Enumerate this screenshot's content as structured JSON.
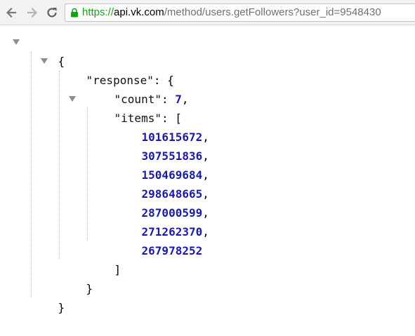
{
  "browser": {
    "url_scheme": "https://",
    "url_host": "api.vk.com",
    "url_path": "/method/users.getFollowers?user_id=9548430",
    "back_icon": "back-arrow-icon",
    "forward_icon": "forward-arrow-icon",
    "reload_icon": "reload-icon",
    "lock_icon": "lock-icon",
    "colors": {
      "secure": "#16a316",
      "path": "#707070",
      "number": "#1a1aa6"
    }
  },
  "json": {
    "open_root": "{",
    "response_key": "\"response\"",
    "response_open": ": {",
    "count_key": "\"count\"",
    "count_sep": ": ",
    "count_value": "7",
    "count_comma": ",",
    "items_key": "\"items\"",
    "items_open": ": [",
    "items": [
      "101615672",
      "307551836",
      "150469684",
      "298648665",
      "287000599",
      "271262370",
      "267978252"
    ],
    "comma": ",",
    "items_close": "]",
    "response_close": "}",
    "close_root": "}"
  }
}
